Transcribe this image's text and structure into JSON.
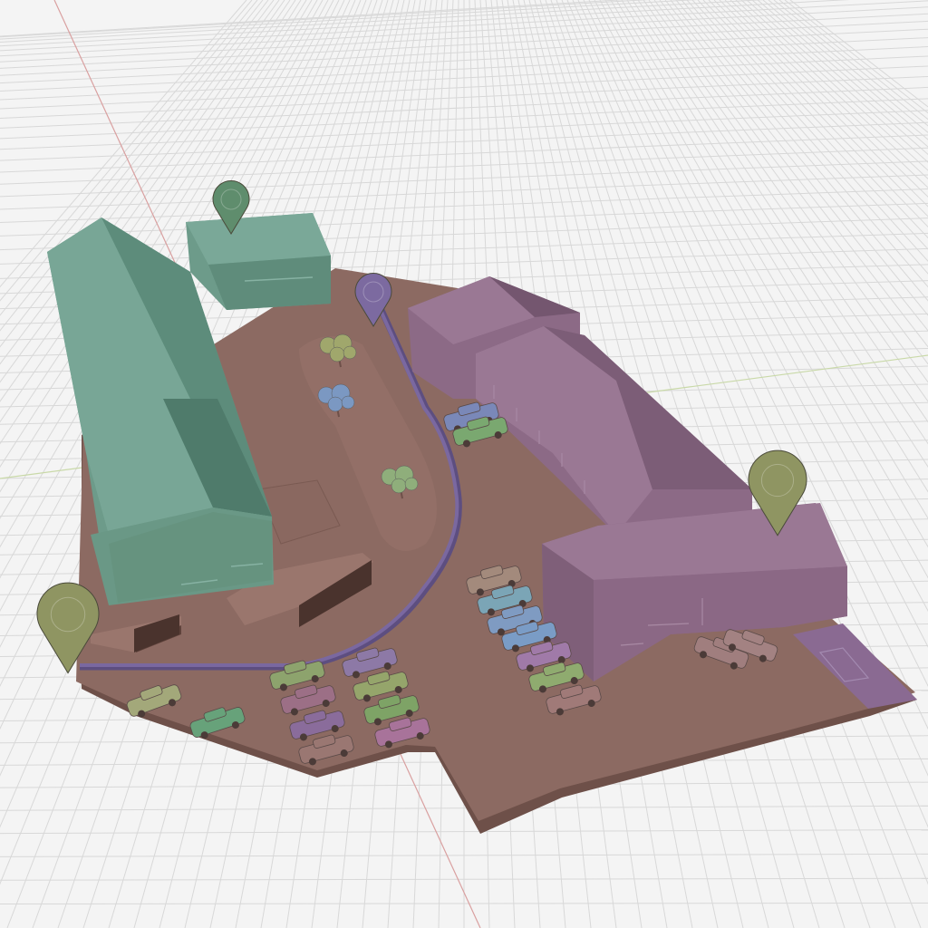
{
  "scene": {
    "colors": {
      "background": "#f4f4f4",
      "grid_line": "#d9d9d9",
      "axis_red": "#d9a0a0",
      "axis_green": "#c9d9a8",
      "ground": "#8c6a62",
      "ground_dark": "#6e5049",
      "green_building": "#6d9b8a",
      "green_building_dark": "#4f7b6b",
      "purple_building": "#8c6a86",
      "purple_building_dark": "#74566f",
      "path": "#7a68a0",
      "pin_olive": "#8f9562",
      "pin_green": "#5f8d6d",
      "pin_purple": "#7c6aa0"
    },
    "map_pins": [
      {
        "name": "pin-green-building",
        "color": "pin_green"
      },
      {
        "name": "pin-purple-path-start",
        "color": "pin_purple"
      },
      {
        "name": "pin-olive-purple-building",
        "color": "pin_olive"
      },
      {
        "name": "pin-olive-corner",
        "color": "pin_olive"
      }
    ],
    "vehicles": [
      {
        "name": "car",
        "color": "#a3a87a"
      },
      {
        "name": "car",
        "color": "#67a27a"
      },
      {
        "name": "car",
        "color": "#8da36d"
      },
      {
        "name": "car",
        "color": "#9c6f86"
      },
      {
        "name": "car",
        "color": "#8a6c9b"
      },
      {
        "name": "car",
        "color": "#9a7772"
      },
      {
        "name": "car",
        "color": "#8d79a6"
      },
      {
        "name": "car",
        "color": "#95a56b"
      },
      {
        "name": "car",
        "color": "#7ea366"
      },
      {
        "name": "car",
        "color": "#a8739a"
      },
      {
        "name": "car",
        "color": "#a38a7c"
      },
      {
        "name": "car",
        "color": "#7ba5b6"
      },
      {
        "name": "car",
        "color": "#7f9bc2"
      },
      {
        "name": "car",
        "color": "#7a9cc6"
      },
      {
        "name": "car",
        "color": "#a07aa8"
      },
      {
        "name": "car",
        "color": "#8fab6f"
      },
      {
        "name": "car",
        "color": "#a07a78"
      },
      {
        "name": "car",
        "color": "#a07e7e"
      },
      {
        "name": "car",
        "color": "#a38282"
      },
      {
        "name": "car",
        "color": "#7a88b8"
      },
      {
        "name": "car",
        "color": "#7aa870"
      }
    ],
    "trees": [
      {
        "name": "tree",
        "color": "#a0a76c"
      },
      {
        "name": "tree",
        "color": "#7b98c2"
      },
      {
        "name": "tree",
        "color": "#8fae7b"
      }
    ]
  }
}
